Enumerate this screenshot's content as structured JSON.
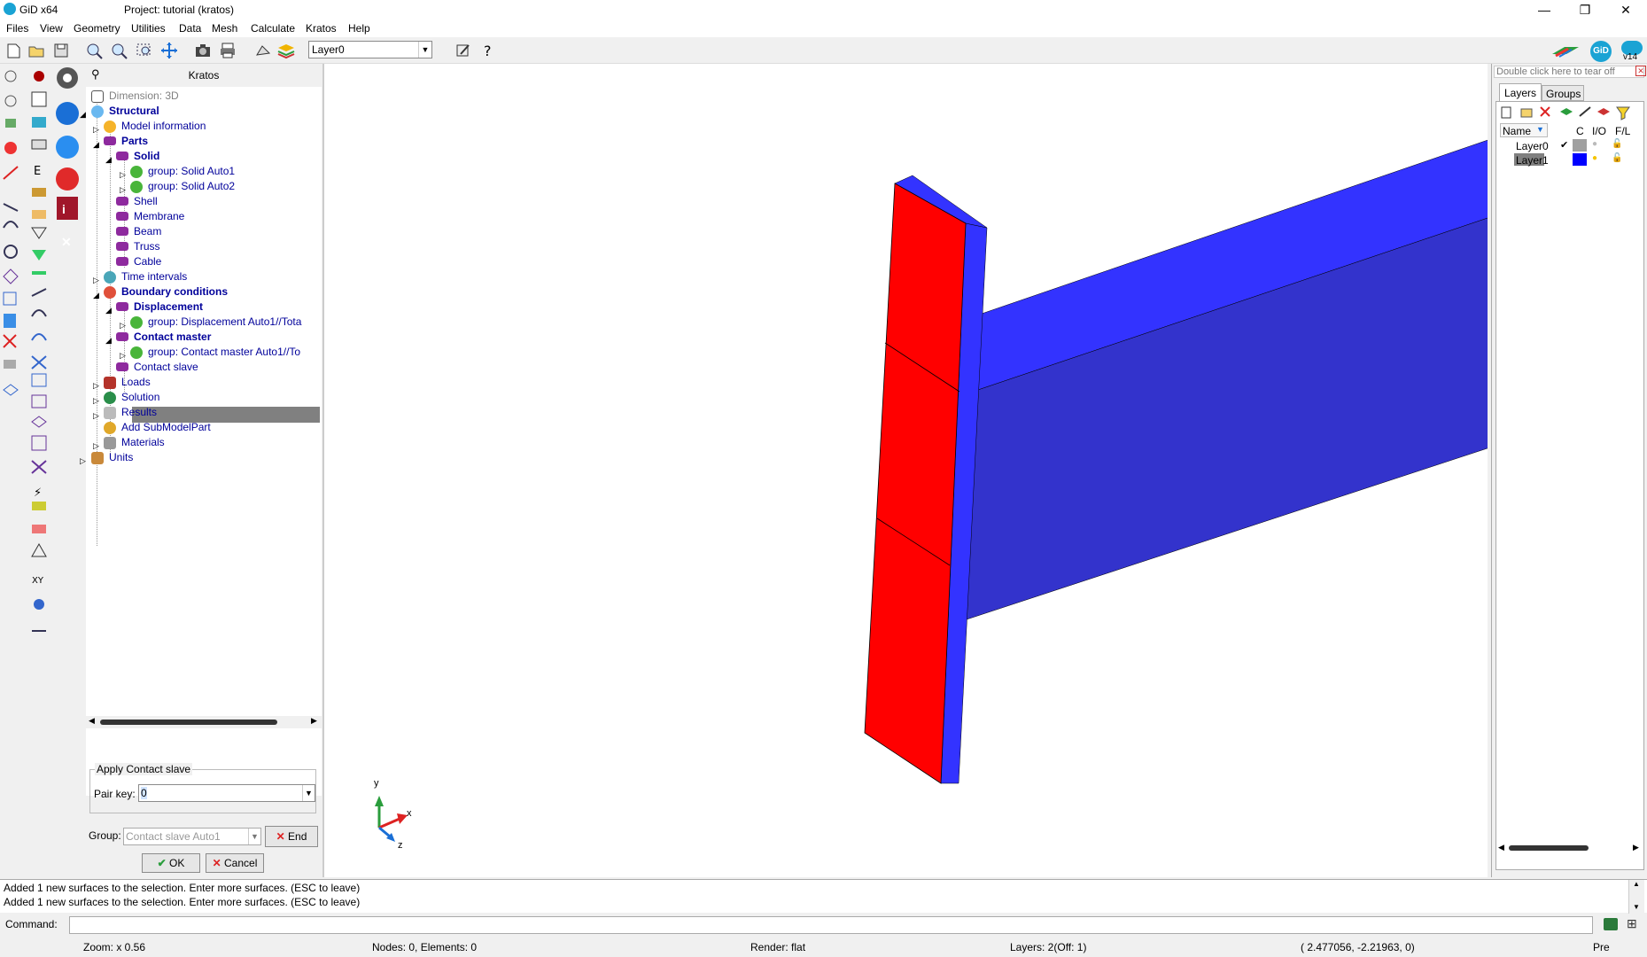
{
  "window": {
    "app_title": "GiD x64",
    "project_title": "Project: tutorial (kratos)",
    "minimize": "—",
    "restore": "❐",
    "close": "✕"
  },
  "menu": [
    "Files",
    "View",
    "Geometry",
    "Utilities",
    "Data",
    "Mesh",
    "Calculate",
    "Kratos",
    "Help"
  ],
  "toolbar": {
    "layer_selected": "Layer0",
    "gid_badge": "GiD",
    "version": "v14"
  },
  "tree": {
    "title": "Kratos",
    "nodes": [
      {
        "label": "Dimension: 3D"
      },
      {
        "label": "Structural"
      },
      {
        "label": "Model information"
      },
      {
        "label": "Parts"
      },
      {
        "label": "Solid"
      },
      {
        "label": "group: Solid Auto1"
      },
      {
        "label": "group: Solid Auto2"
      },
      {
        "label": "Shell"
      },
      {
        "label": "Membrane"
      },
      {
        "label": "Beam"
      },
      {
        "label": "Truss"
      },
      {
        "label": "Cable"
      },
      {
        "label": "Time intervals"
      },
      {
        "label": "Boundary conditions"
      },
      {
        "label": "Displacement"
      },
      {
        "label": "group: Displacement Auto1//Tota"
      },
      {
        "label": "Contact master"
      },
      {
        "label": "group: Contact master Auto1//To"
      },
      {
        "label": "Contact slave"
      },
      {
        "label": "Loads"
      },
      {
        "label": "Solution"
      },
      {
        "label": "Results"
      },
      {
        "label": "Add SubModelPart"
      },
      {
        "label": "Materials"
      },
      {
        "label": "Units"
      }
    ]
  },
  "apply_panel": {
    "legend": "Apply Contact slave",
    "pair_key_label": "Pair key:",
    "pair_key_value": "0",
    "group_label": "Group:",
    "group_placeholder": "Contact slave Auto1",
    "end_label": "End",
    "ok_label": "OK",
    "cancel_label": "Cancel"
  },
  "axes": {
    "x": "x",
    "y": "y",
    "z": "z"
  },
  "layers_panel": {
    "tearoff": "Double click here to tear off",
    "tab_layers": "Layers",
    "tab_groups": "Groups",
    "col_name": "Name",
    "col_c": "C",
    "col_io": "I/O",
    "col_fl": "F/L",
    "rows": [
      {
        "name": "Layer0",
        "check": "✔",
        "color": "#a0a0a0"
      },
      {
        "name": "Layer1",
        "check": "",
        "color": "#0000ff"
      }
    ]
  },
  "messages": [
    "Added 1 new  surfaces to the selection. Enter more surfaces. (ESC to leave)",
    "Added 1 new  surfaces to the selection. Enter more surfaces. (ESC to leave)"
  ],
  "command_label": "Command:",
  "status": {
    "zoom": "Zoom: x 0.56",
    "nodes": "Nodes: 0, Elements: 0",
    "render": "Render: flat",
    "layers": "Layers: 2(Off: 1)",
    "coords": "( 2.477056, -2.21963, 0)",
    "mode": "Pre"
  },
  "colors": {
    "slave_red": "#ff0000",
    "beam_blue": "#3333ff",
    "beam_side": "#3333cc",
    "tree_text": "#00009a"
  }
}
